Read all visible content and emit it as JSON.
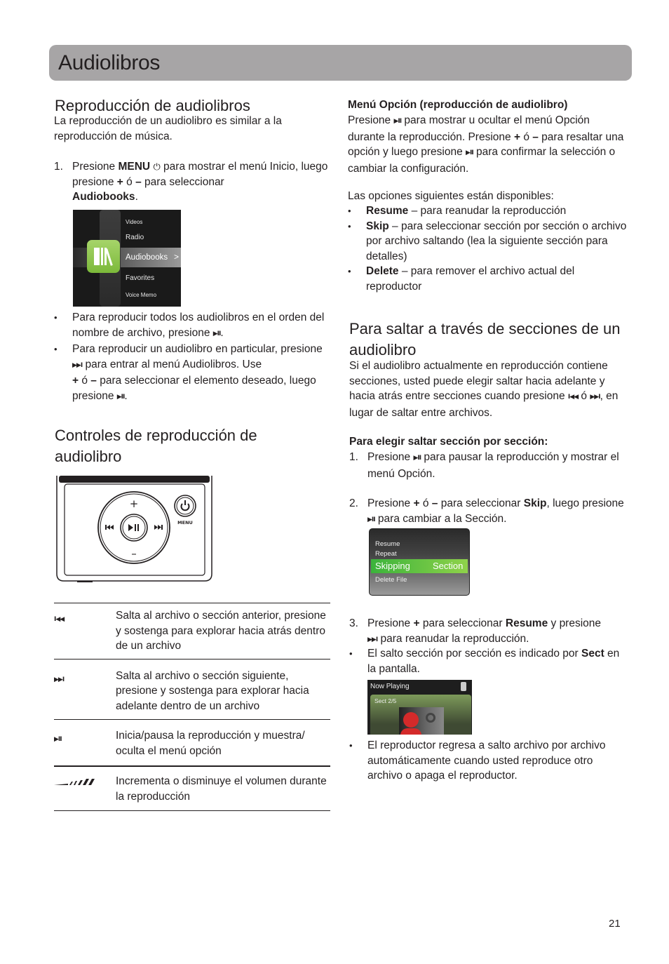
{
  "page": {
    "title": "Audiolibros",
    "page_number": "21"
  },
  "left": {
    "section1": {
      "heading": "Reproducción de audiolibros",
      "intro": "La reproducción de un audiolibro es similar a la reproducción de música.",
      "step1": {
        "num": "1.",
        "a": "Presione ",
        "b_menu": "MENU",
        "c": " para mostrar el menú Inicio, luego presione ",
        "plus": "+",
        "d": " ó ",
        "minus": "–",
        "e": " para seleccionar ",
        "b_audiobooks": "Audiobooks",
        "f": "."
      },
      "home_menu": {
        "items": [
          "Videos",
          "Radio",
          "Audiobooks",
          "Favorites",
          "Voice Memo"
        ],
        "selected": "Audiobooks",
        "accent_color": "#8cc63f"
      },
      "bullet1": {
        "a": "Para reproducir todos los audiolibros en el orden del nombre de archivo, presione ",
        "b": "."
      },
      "bullet2": {
        "a": "Para reproducir un audiolibro en particular, presione ",
        "b": " para entrar al menú Audiolibros. Use ",
        "plus": "+",
        "c": " ó ",
        "minus": "–",
        "d": " para seleccionar el elemento deseado, luego presione ",
        "e": "."
      }
    },
    "section2": {
      "heading": "Controles de reproducción de audiolibro",
      "player": {
        "plus": "+",
        "minus": "–",
        "menu_label": "MENU"
      },
      "controls": [
        {
          "icon": "previous-icon",
          "glyph": "I◀◀",
          "description": "Salta al archivo o sección anterior, presione y sostenga para explorar hacia atrás dentro de un archivo"
        },
        {
          "icon": "next-icon",
          "glyph": "▶▶I",
          "description": "Salta al archivo o sección siguiente, presione y sostenga para explorar hacia adelante dentro de un archivo"
        },
        {
          "icon": "play-pause-icon",
          "glyph": "▶II",
          "description": "Inicia/pausa la reproducción y muestra/ oculta el menú opción"
        },
        {
          "icon": "volume-icon",
          "glyph": "",
          "description": "Incrementa o disminuye el volumen durante la reproducción"
        }
      ]
    }
  },
  "right": {
    "option_menu": {
      "heading": "Menú Opción (reproducción de audiolibro)",
      "p1_a": "Presione ",
      "p1_b": " para mostrar u ocultar el menú Opción durante la reproducción. Presione ",
      "plus": "+",
      "p1_c": " ó ",
      "minus": "–",
      "p1_d": " para resaltar una opción y luego presione ",
      "p1_e": " para confirmar la selección o cambiar la configuración.",
      "available": "Las opciones siguientes están disponibles:",
      "options": [
        {
          "name": "Resume",
          "desc": " – para reanudar la reproducción"
        },
        {
          "name": "Skip",
          "desc": " – para seleccionar sección por sección o archivo por archivo saltando (lea la siguiente sección para detalles)"
        },
        {
          "name": "Delete",
          "desc": " – para remover el archivo actual del reproductor"
        }
      ]
    },
    "skip_section": {
      "heading": "Para saltar a través de secciones de un audiolibro",
      "p_a": "Si el audiolibro actualmente en reproducción contiene secciones, usted puede elegir saltar hacia adelante y hacia atrás entre secciones cuando presione ",
      "p_b": " ó ",
      "p_c": ", en lugar de saltar entre archivos.",
      "subheading": "Para elegir saltar sección por sección:",
      "step1": {
        "num": "1.",
        "a": "Presione ",
        "b": " para pausar la reproducción y mostrar el menú Opción."
      },
      "step2": {
        "num": "2.",
        "a": "Presione ",
        "plus": "+",
        "b": " ó ",
        "minus": "–",
        "c": " para seleccionar ",
        "bold": "Skip",
        "d": ", luego presione ",
        "e": " para cambiar a la Sección."
      },
      "option_screen": {
        "items": [
          "Resume",
          "Repeat",
          "Skipping",
          "Delete File"
        ],
        "selected_label": "Skipping",
        "selected_value": "Section",
        "accent_color": "#5cbf3f"
      },
      "step3": {
        "num": "3.",
        "a": "Presione ",
        "plus": "+",
        "b": " para seleccionar ",
        "bold": "Resume",
        "c": " y presione ",
        "d": " para reanudar la reproducción."
      },
      "bullet_sect": {
        "a": "El salto sección por sección es indicado por ",
        "bold": "Sect",
        "b": " en la pantalla."
      },
      "now_playing": {
        "title": "Now Playing",
        "section": "Sect 2/5"
      },
      "bullet_return": "El reproductor regresa a salto archivo por archivo automáticamente cuando usted reproduce otro archivo o apaga el reproductor."
    }
  }
}
